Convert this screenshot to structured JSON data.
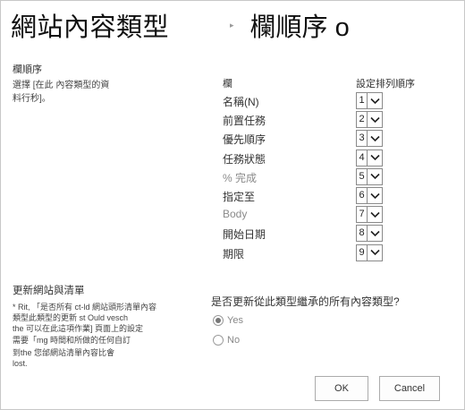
{
  "header": {
    "title": "網站內容類型",
    "separator": "▸",
    "subtitle": "欄順序 o"
  },
  "order_section": {
    "heading": "欄順序",
    "description": [
      "選擇 [在此 內容類型的資",
      "料行秒]。"
    ]
  },
  "columns_table": {
    "col_header": "欄",
    "order_header": "設定排列順序",
    "rows": [
      {
        "name": "名稱(N)",
        "order": "1"
      },
      {
        "name": "前置任務",
        "order": "2"
      },
      {
        "name": "優先順序",
        "order": "3"
      },
      {
        "name": "任務狀態",
        "order": "4"
      },
      {
        "name": "% 完成",
        "order": "5"
      },
      {
        "name": "指定至",
        "order": "6"
      },
      {
        "name": "Body",
        "order": "7"
      },
      {
        "name": "開始日期",
        "order": "8"
      },
      {
        "name": "期限",
        "order": "9"
      }
    ]
  },
  "update_section": {
    "heading": "更新網站與清單",
    "description": [
      "* Rit, 「是否所有 ct-ld 網站頭形清單內容",
      "類型此類型的更新 st Ould vesch",
      "the 可以在此這項作業] 頁面上的設定",
      "需要「mg 時間和所做的任何自訂",
      "到the 您邰網站清單內容比會",
      "lost."
    ],
    "question": "是否更新從此類型繼承的所有內容類型?",
    "options": [
      "Yes",
      "No"
    ],
    "selected": "Yes"
  },
  "buttons": {
    "ok": "OK",
    "cancel": "Cancel"
  }
}
